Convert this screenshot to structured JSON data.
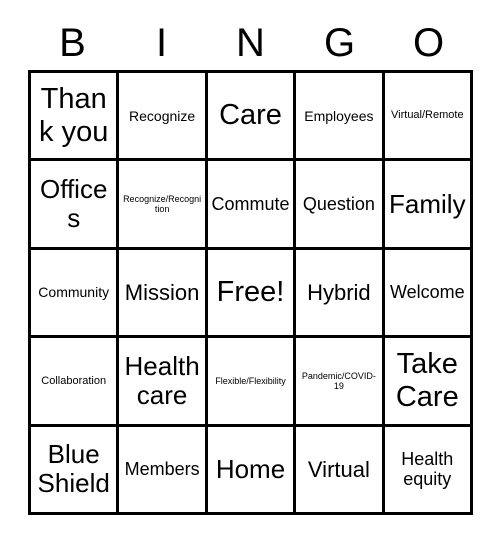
{
  "card": {
    "title": "Bingo Card",
    "header_letters": [
      "B",
      "I",
      "N",
      "G",
      "O"
    ],
    "colors": {
      "background": "#ffffff",
      "text": "#000000",
      "border": "#000000"
    },
    "grid_size": "5x5",
    "free_space": "Free!",
    "rows": [
      [
        {
          "label": "Thank you",
          "size": "xxl"
        },
        {
          "label": "Recognize",
          "size": "s"
        },
        {
          "label": "Care",
          "size": "xxl"
        },
        {
          "label": "Employees",
          "size": "s"
        },
        {
          "label": "Virtual/Remote",
          "size": "xs"
        }
      ],
      [
        {
          "label": "Offices",
          "size": "xl"
        },
        {
          "label": "Recognize/Recognition",
          "size": "xxs"
        },
        {
          "label": "Commute",
          "size": "m"
        },
        {
          "label": "Question",
          "size": "m"
        },
        {
          "label": "Family",
          "size": "xl"
        }
      ],
      [
        {
          "label": "Community",
          "size": "s"
        },
        {
          "label": "Mission",
          "size": "l"
        },
        {
          "label": "Free!",
          "size": "xxl"
        },
        {
          "label": "Hybrid",
          "size": "l"
        },
        {
          "label": "Welcome",
          "size": "m"
        }
      ],
      [
        {
          "label": "Collaboration",
          "size": "xs"
        },
        {
          "label": "Health care",
          "size": "xl"
        },
        {
          "label": "Flexible/Flexibility",
          "size": "xxs"
        },
        {
          "label": "Pandemic/COVID-19",
          "size": "xxs"
        },
        {
          "label": "Take Care",
          "size": "xxl"
        }
      ],
      [
        {
          "label": "Blue Shield",
          "size": "xl"
        },
        {
          "label": "Members",
          "size": "m"
        },
        {
          "label": "Home",
          "size": "xl"
        },
        {
          "label": "Virtual",
          "size": "l"
        },
        {
          "label": "Health equity",
          "size": "m"
        }
      ]
    ]
  }
}
